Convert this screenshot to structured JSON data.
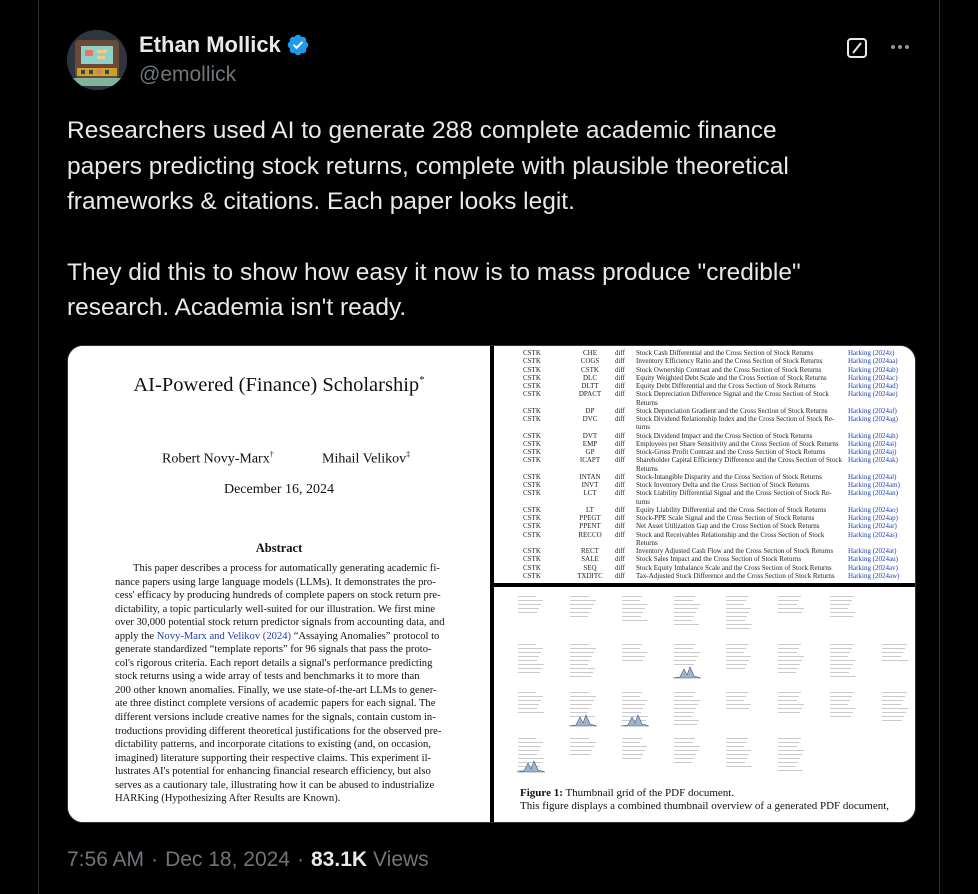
{
  "author": {
    "name": "Ethan Mollick",
    "handle": "@emollick",
    "verified": true
  },
  "tweet": {
    "lines": [
      "Researchers used AI to generate 288 complete academic finance",
      "papers predicting stock returns, complete with plausible theoretical",
      "frameworks & citations. Each paper looks legit.",
      "They did this to show how easy it now is to mass produce \"credible\"",
      "research. Academia isn't ready."
    ]
  },
  "media": {
    "paper": {
      "title": "AI-Powered (Finance) Scholarship",
      "title_mark": "*",
      "author1": "Robert Novy-Marx",
      "author1_mark": "†",
      "author2": "Mihail Velikov",
      "author2_mark": "‡",
      "date": "December 16, 2024",
      "abstract_heading": "Abstract",
      "abstract_lines": [
        "This paper describes a process for automatically generating academic fi-",
        "nance papers using large language models (LLMs). It demonstrates the pro-",
        "cess' efficacy by producing hundreds of complete papers on stock return pre-",
        "dictability, a topic particularly well-suited for our illustration. We first mine",
        "over 30,000 potential stock return predictor signals from accounting data, and",
        "apply the |Novy-Marx and Velikov (2024)| “Assaying Anomalies” protocol to",
        "generate standardized “template reports” for 96 signals that pass the proto-",
        "col's rigorous criteria. Each report details a signal's performance predicting",
        "stock returns using a wide array of tests and benchmarks it to more than",
        "200 other known anomalies. Finally, we use state-of-the-art LLMs to gener-",
        "ate three distinct complete versions of academic papers for each signal. The",
        "different versions include creative names for the signals, contain custom in-",
        "troductions providing different theoretical justifications for the observed pre-",
        "dictability patterns, and incorporate citations to existing (and, on occasion,",
        "imagined) literature supporting their respective claims. This experiment il-",
        "lustrates AI's potential for enhancing financial research efficiency, but also",
        "serves as a cautionary tale, illustrating how it can be abused to industrialize",
        "HARKing (Hypothesizing After Results are Known)."
      ]
    },
    "table_rows": [
      {
        "src": "CSTK",
        "sig": "CHE",
        "type": "diff",
        "desc": "Stock Cash Differential and the Cross Section of Stock Returns",
        "ref": "Harking (2024z)"
      },
      {
        "src": "CSTK",
        "sig": "COGS",
        "type": "diff",
        "desc": "Inventory Efficiency Ratio and the Cross Section of Stock Returns",
        "ref": "Harking (2024aa)"
      },
      {
        "src": "CSTK",
        "sig": "CSTK",
        "type": "diff",
        "desc": "Stock Ownership Contrast and the Cross Section of Stock Returns",
        "ref": "Harking (2024ab)"
      },
      {
        "src": "CSTK",
        "sig": "DLC",
        "type": "diff",
        "desc": "Equity Weighted Debt Scale and the Cross Section of Stock Returns",
        "ref": "Harking (2024ac)"
      },
      {
        "src": "CSTK",
        "sig": "DLTT",
        "type": "diff",
        "desc": "Equity Debt Differential and the Cross Section of Stock Returns",
        "ref": "Harking (2024ad)"
      },
      {
        "src": "CSTK",
        "sig": "DPACT",
        "type": "diff",
        "desc": "Stock Depreciation Difference Signal and the Cross Section of Stock",
        "ref": "Harking (2024ae)"
      },
      {
        "src": "",
        "sig": "",
        "type": "",
        "desc": "Returns",
        "ref": ""
      },
      {
        "src": "CSTK",
        "sig": "DP",
        "type": "diff",
        "desc": "Stock Depreciation Gradient and the Cross Section of Stock Returns",
        "ref": "Harking (2024af)"
      },
      {
        "src": "CSTK",
        "sig": "DVC",
        "type": "diff",
        "desc": "Stock Dividend Relationship Index and the Cross Section of Stock Re-",
        "ref": "Harking (2024ag)"
      },
      {
        "src": "",
        "sig": "",
        "type": "",
        "desc": "turns",
        "ref": ""
      },
      {
        "src": "CSTK",
        "sig": "DVT",
        "type": "diff",
        "desc": "Stock Dividend Impact and the Cross Section of Stock Returns",
        "ref": "Harking (2024ah)"
      },
      {
        "src": "CSTK",
        "sig": "EMP",
        "type": "diff",
        "desc": "Employees per Share Sensitivity and the Cross Section of Stock Returns",
        "ref": "Harking (2024ai)"
      },
      {
        "src": "CSTK",
        "sig": "GP",
        "type": "diff",
        "desc": "Stock-Gross Profit Contrast and the Cross Section of Stock Returns",
        "ref": "Harking (2024aj)"
      },
      {
        "src": "CSTK",
        "sig": "ICAPT",
        "type": "diff",
        "desc": "Shareholder Capital Efficiency Difference and the Cross Section of Stock",
        "ref": "Harking (2024ak)"
      },
      {
        "src": "",
        "sig": "",
        "type": "",
        "desc": "Returns",
        "ref": ""
      },
      {
        "src": "CSTK",
        "sig": "INTAN",
        "type": "diff",
        "desc": "Stock-Intangible Disparity and the Cross Section of Stock Returns",
        "ref": "Harking (2024al)"
      },
      {
        "src": "CSTK",
        "sig": "INVT",
        "type": "diff",
        "desc": "Stock Inventory Delta and the Cross Section of Stock Returns",
        "ref": "Harking (2024am)"
      },
      {
        "src": "CSTK",
        "sig": "LCT",
        "type": "diff",
        "desc": "Stock Liability Differential Signal and the Cross Section of Stock Re-",
        "ref": "Harking (2024an)"
      },
      {
        "src": "",
        "sig": "",
        "type": "",
        "desc": "turns",
        "ref": ""
      },
      {
        "src": "CSTK",
        "sig": "LT",
        "type": "diff",
        "desc": "Equity Liability Differential and the Cross Section of Stock Returns",
        "ref": "Harking (2024ao)"
      },
      {
        "src": "CSTK",
        "sig": "PPEGT",
        "type": "diff",
        "desc": "Stock-PPE Scale Signal and the Cross Section of Stock Returns",
        "ref": "Harking (2024ap)"
      },
      {
        "src": "CSTK",
        "sig": "PPENT",
        "type": "diff",
        "desc": "Net Asset Utilization Gap and the Cross Section of Stock Returns",
        "ref": "Harking (2024ar)"
      },
      {
        "src": "CSTK",
        "sig": "RECCO",
        "type": "diff",
        "desc": "Stock and Receivables Relationship and the Cross Section of Stock",
        "ref": "Harking (2024as)"
      },
      {
        "src": "",
        "sig": "",
        "type": "",
        "desc": "Returns",
        "ref": ""
      },
      {
        "src": "CSTK",
        "sig": "RECT",
        "type": "diff",
        "desc": "Inventory Adjusted Cash Flow and the Cross Section of Stock Returns",
        "ref": "Harking (2024at)"
      },
      {
        "src": "CSTK",
        "sig": "SALE",
        "type": "diff",
        "desc": "Stock Sales Impact and the Cross Section of Stock Returns",
        "ref": "Harking (2024au)"
      },
      {
        "src": "CSTK",
        "sig": "SEQ",
        "type": "diff",
        "desc": "Stock Equity Imbalance Scale and the Cross Section of Stock Returns",
        "ref": "Harking (2024av)"
      },
      {
        "src": "CSTK",
        "sig": "TXDITC",
        "type": "diff",
        "desc": "Tax-Adjusted Stock Difference and the Cross Section of Stock Returns",
        "ref": "Harking (2024aw)"
      }
    ],
    "figure": {
      "label": "Figure 1:",
      "title": "Thumbnail grid of the PDF document.",
      "line2": "This figure displays a combined thumbnail overview of a generated PDF document,"
    }
  },
  "meta": {
    "time": "7:56 AM",
    "separator": "·",
    "date": "Dec 18, 2024",
    "views_count": "83.1K",
    "views_label": "Views"
  },
  "colors": {
    "background": "#000000",
    "text": "#e7e9ea",
    "muted": "#71767b",
    "verified_blue": "#1d9bf0",
    "paper_link": "#1f3fb0"
  },
  "icons": [
    "verified-badge-icon",
    "grok-icon",
    "more-icon"
  ]
}
